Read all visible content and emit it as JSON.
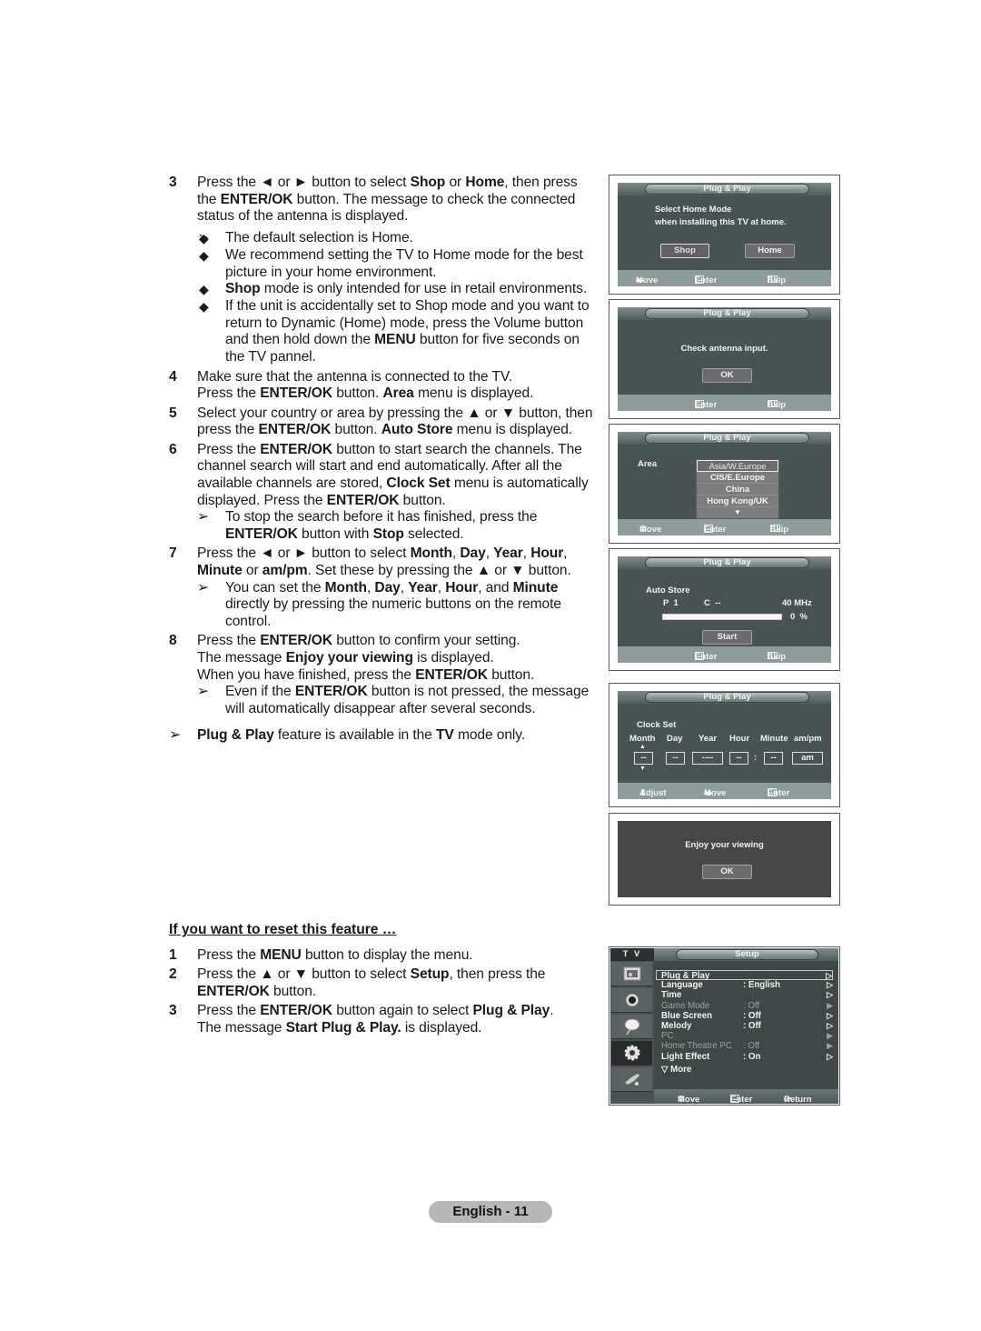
{
  "steps_top": [
    {
      "num": "3",
      "lines": [
        "Press the ◄ or ► button to select ",
        "Shop",
        " or ",
        "Home",
        ", then press the ",
        "ENTER/OK",
        " button. The message to check the connected status of the antenna is displayed."
      ],
      "bullets": [
        "The default selection is Home.",
        "We recommend setting the TV to Home mode for the best picture in your home environment.",
        [
          "Shop",
          " mode is only intended for use in retail environments."
        ],
        [
          "If the unit is accidentally set to Shop mode and you want to return to Dynamic (Home) mode, press the Volume button and then hold down the ",
          "MENU",
          " button for five seconds on the TV pannel."
        ]
      ]
    },
    {
      "num": "4",
      "text": [
        "Make sure that the antenna is connected to the TV.",
        "Press the ",
        "ENTER/OK",
        " button. ",
        "Area",
        " menu is displayed."
      ]
    },
    {
      "num": "5",
      "text": [
        "Select your country or area by pressing the ▲ or ▼ button, then press the ",
        "ENTER/OK",
        " button. ",
        "Auto Store",
        " menu is displayed."
      ]
    },
    {
      "num": "6",
      "text": [
        "Press the ",
        "ENTER/OK",
        " button to start search the channels. The channel search will start and end automatically. After all the available channels are stored, ",
        "Clock Set",
        " menu is automatically displayed. Press the ",
        "ENTER/OK",
        " button."
      ],
      "note": [
        "To stop the search before it has finished, press the ",
        "ENTER/OK",
        " button with ",
        "Stop",
        " selected."
      ]
    },
    {
      "num": "7",
      "text": [
        "Press the ◄ or ► button to select ",
        "Month",
        ", ",
        "Day",
        ", ",
        "Year",
        ", ",
        "Hour",
        ", ",
        "Minute",
        " or ",
        "am/pm",
        ". Set these by pressing the ▲ or ▼ button."
      ],
      "note": [
        "You can set the ",
        "Month",
        ", ",
        "Day",
        ", ",
        "Year",
        ", ",
        "Hour",
        ", and ",
        "Minute",
        " directly by pressing the numeric buttons on the remote control."
      ]
    },
    {
      "num": "8",
      "text": [
        "Press the ",
        "ENTER/OK",
        " button to confirm your setting.",
        "The message ",
        "Enjoy your viewing",
        " is displayed.",
        "When you have finished, press the ",
        "ENTER/OK",
        " button."
      ],
      "note": [
        "Even if the ",
        "ENTER/OK",
        " button is not pressed, the message will automatically disappear after several seconds."
      ]
    }
  ],
  "final_note": [
    "Plug & Play",
    " feature is available in the ",
    "TV",
    " mode only."
  ],
  "reset": {
    "title": "If you want to reset this feature …",
    "steps": [
      {
        "num": "1",
        "text": [
          "Press the ",
          "MENU",
          " button to display the menu."
        ]
      },
      {
        "num": "2",
        "text": [
          "Press the ▲ or ▼ button to select ",
          "Setup",
          ", then press the ",
          "ENTER/OK",
          " button."
        ]
      },
      {
        "num": "3",
        "text": [
          "Press the ",
          "ENTER/OK",
          " button again to select ",
          "Plug & Play",
          ".",
          "The message ",
          "Start Plug & Play.",
          " is displayed."
        ]
      }
    ]
  },
  "screens": {
    "home_mode": {
      "title": "Plug & Play",
      "line1": "Select Home Mode",
      "line2": "when installing this TV at home.",
      "btn_shop": "Shop",
      "btn_home": "Home",
      "foot": {
        "move": "Move",
        "enter": "Enter",
        "skip": "Skip"
      }
    },
    "antenna": {
      "title": "Plug & Play",
      "message": "Check antenna input.",
      "btn_ok": "OK",
      "foot": {
        "enter": "Enter",
        "skip": "Skip"
      }
    },
    "area": {
      "title": "Plug & Play",
      "label": "Area",
      "options": [
        "Asia/W.Europe",
        "CIS/E.Europe",
        "China",
        "Hong Kong/UK"
      ],
      "selected": "Asia/W.Europe",
      "foot": {
        "move": "Move",
        "enter": "Enter",
        "skip": "Skip"
      }
    },
    "auto_store": {
      "title": "Plug & Play",
      "label": "Auto Store",
      "program": "P  1",
      "channel": "C  --",
      "frequency": "40 MHz",
      "progress_text": "0  %",
      "progress_percent": 0,
      "btn_start": "Start",
      "foot": {
        "enter": "Enter",
        "skip": "Skip"
      }
    },
    "clock_set": {
      "title": "Plug & Play",
      "label": "Clock Set",
      "headers": [
        "Month",
        "Day",
        "Year",
        "Hour",
        "Minute",
        "am/pm"
      ],
      "values": {
        "month": "--",
        "day": "--",
        "year": "----",
        "hour": "--",
        "separator": ":",
        "minute": "--",
        "ampm": "am"
      },
      "foot": {
        "adjust": "Adjust",
        "move": "Move",
        "enter": "Enter"
      }
    },
    "enjoy": {
      "message": "Enjoy your viewing",
      "btn_ok": "OK"
    },
    "setup": {
      "side_header": "T V",
      "title": "Setup",
      "items": [
        {
          "label": "Plug & Play",
          "value": "",
          "enabled": true
        },
        {
          "label": "Language",
          "value": ": English",
          "enabled": true
        },
        {
          "label": "Time",
          "value": "",
          "enabled": true
        },
        {
          "label": "Game Mode",
          "value": ": Off",
          "enabled": false
        },
        {
          "label": "Blue Screen",
          "value": ": Off",
          "enabled": true
        },
        {
          "label": "Melody",
          "value": ": Off",
          "enabled": true
        },
        {
          "label": "PC",
          "value": "",
          "enabled": false
        },
        {
          "label": "Home Theatre PC",
          "value": ": Off",
          "enabled": false
        },
        {
          "label": "Light Effect",
          "value": ": On",
          "enabled": true
        }
      ],
      "more": "▽ More",
      "foot": {
        "move": "Move",
        "enter": "Enter",
        "return": "Return"
      }
    }
  },
  "page_label": "English - 11"
}
